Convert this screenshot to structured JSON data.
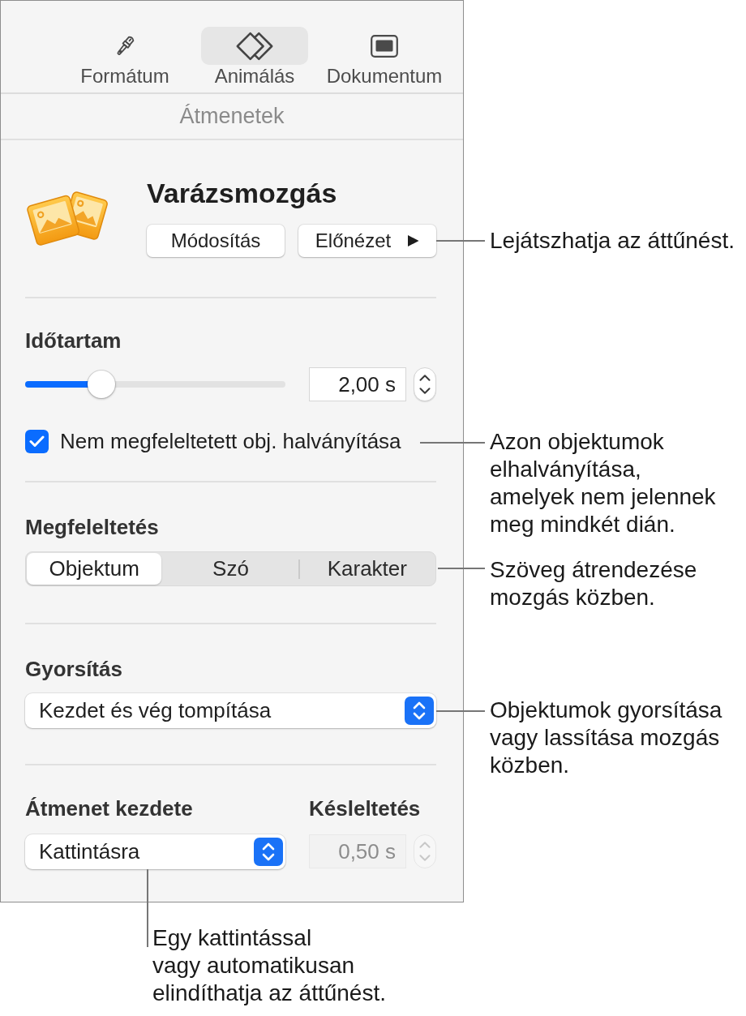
{
  "toolbar": {
    "tabs": [
      {
        "label": "Formátum",
        "selected": false
      },
      {
        "label": "Animálás",
        "selected": true
      },
      {
        "label": "Dokumentum",
        "selected": false
      }
    ]
  },
  "section_header": "Átmenetek",
  "transition": {
    "title": "Varázsmozgás",
    "edit_button": {
      "label": "Módosítás"
    },
    "preview_button": {
      "label": "Előnézet"
    }
  },
  "duration": {
    "label": "Időtartam",
    "slider": {
      "level": 0.27
    },
    "value": "2,00 s"
  },
  "dim_unmatched": {
    "label": "Nem megfeleltetett obj. halványítása",
    "checked": true
  },
  "matching": {
    "label": "Megfeleltetés",
    "segments": [
      {
        "label": "Objektum",
        "selected": true
      },
      {
        "label": "Szó",
        "selected": false
      },
      {
        "label": "Karakter",
        "selected": false
      }
    ]
  },
  "acceleration": {
    "label": "Gyorsítás",
    "value": "Kezdet és vég tompítása"
  },
  "start": {
    "label": "Átmenet kezdete",
    "value": "Kattintásra"
  },
  "delay": {
    "label": "Késleltetés",
    "value": "0,50 s",
    "disabled": true
  },
  "callouts": [
    {
      "text": "Lejátszhatja az áttűnést."
    },
    {
      "text": "Azon objektumok\nelhalványítása,\namelyek nem jelennek\nmeg mindkét dián."
    },
    {
      "text": "Szöveg átrendezése\nmozgás közben."
    },
    {
      "text": "Objektumok gyorsítása\nvagy lassítása mozgás\nközben."
    },
    {
      "text": "Egy kattintással\nvagy automatikusan\nelindíthatja az áttűnést."
    }
  ]
}
